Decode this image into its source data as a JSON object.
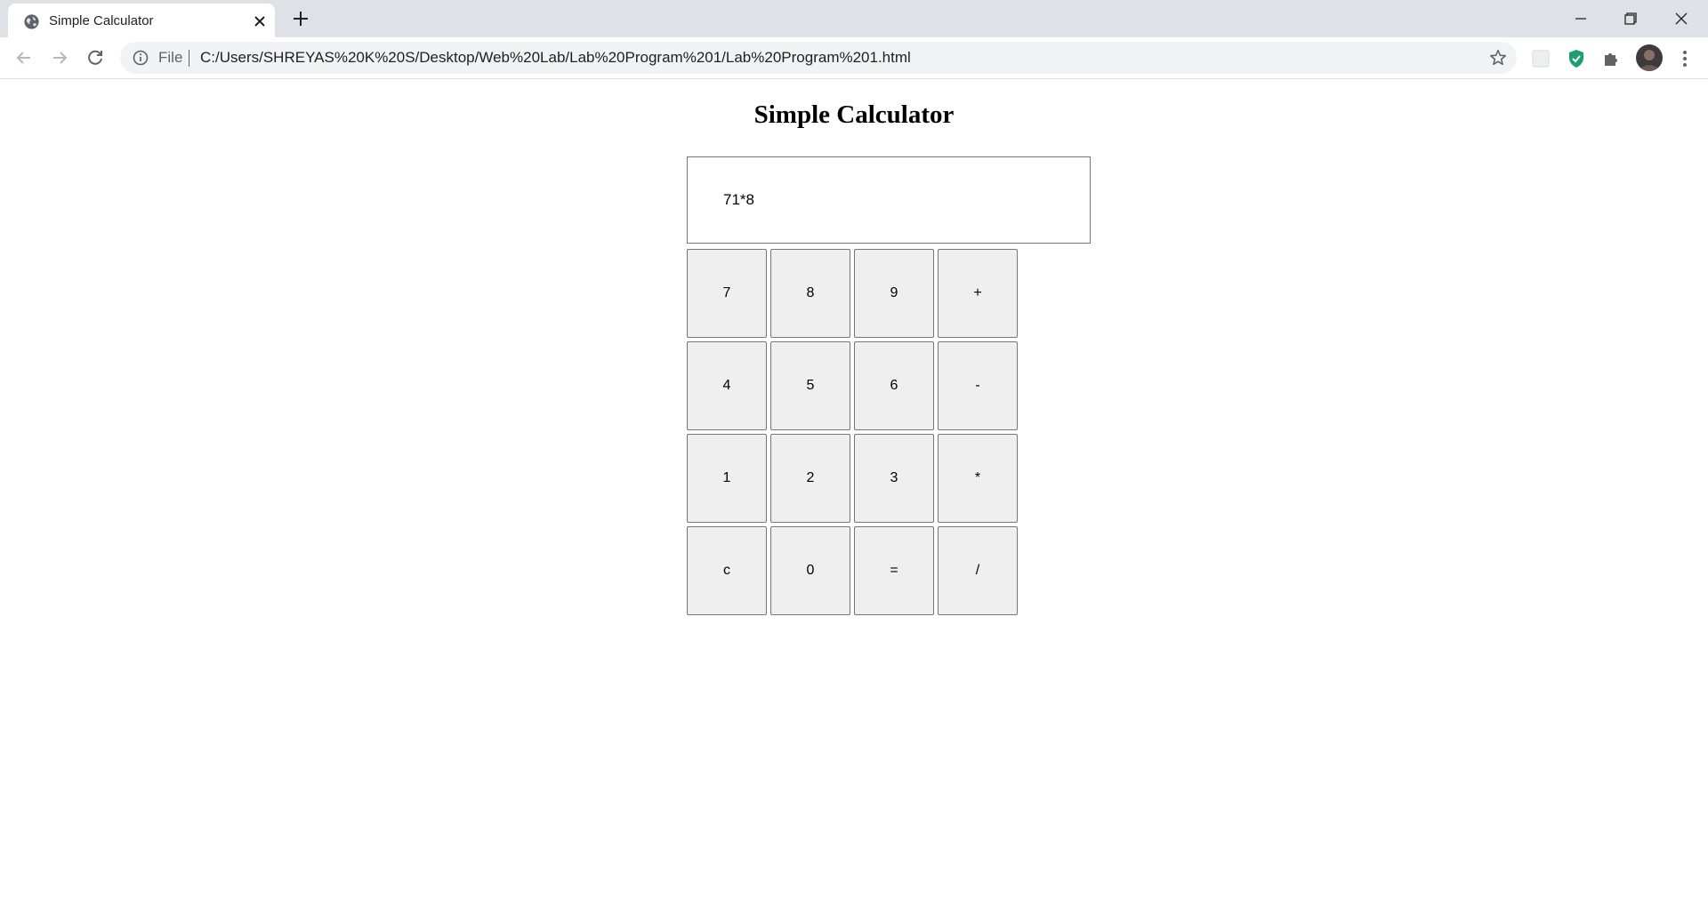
{
  "browser": {
    "tab_title": "Simple Calculator",
    "omnibox": {
      "scheme_label": "File",
      "url": "C:/Users/SHREYAS%20K%20S/Desktop/Web%20Lab/Lab%20Program%201/Lab%20Program%201.html"
    }
  },
  "page": {
    "title": "Simple Calculator",
    "display_value": "71*8",
    "keys": [
      "7",
      "8",
      "9",
      "+",
      "4",
      "5",
      "6",
      "-",
      "1",
      "2",
      "3",
      "*",
      "c",
      "0",
      "=",
      "/"
    ]
  }
}
